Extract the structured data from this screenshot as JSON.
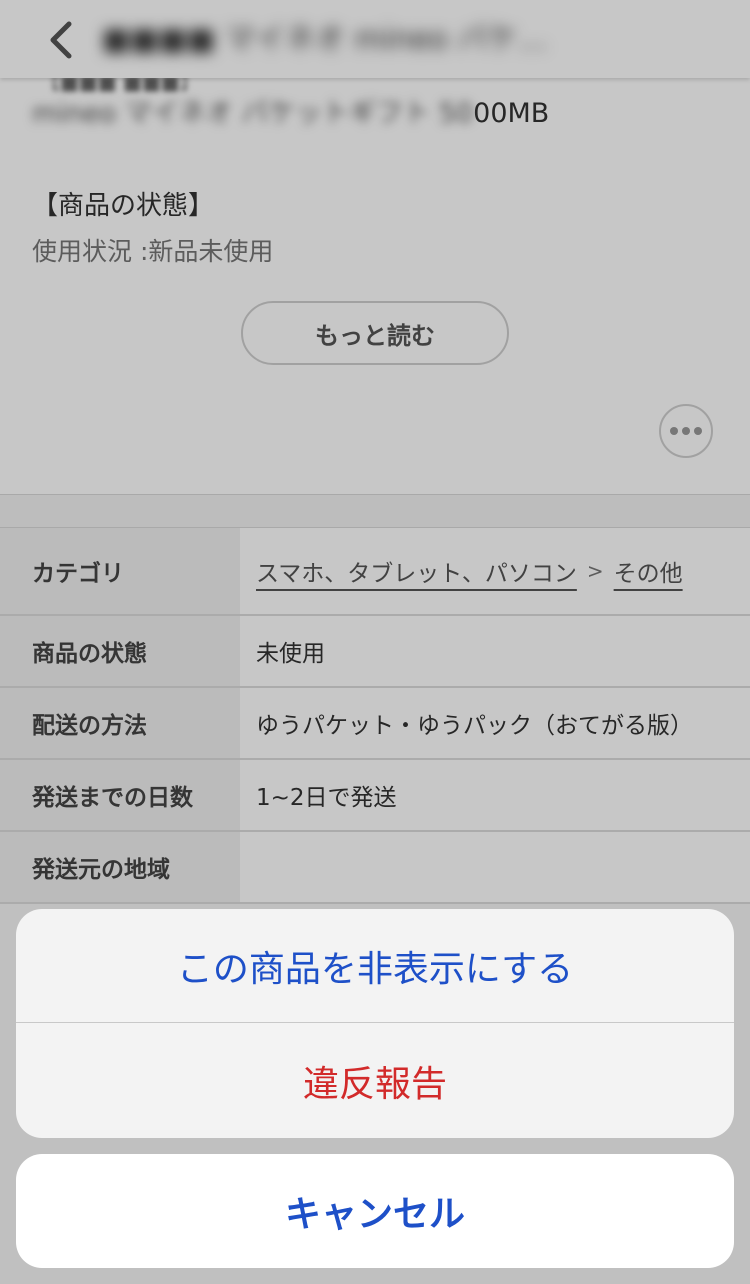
{
  "navbar": {
    "title": "■■■■ マイネオ mineo パケ…"
  },
  "description": {
    "cut_line": "【■■■ ■■■】",
    "line1_blurred": "mineo マイネオ パケットギフト 50",
    "line1_visible": "00MB",
    "heading": "【商品の状態】",
    "line2": "使用状況 :新品未使用",
    "read_more": "もっと読む"
  },
  "info": {
    "rows": [
      {
        "label": "カテゴリ",
        "link1": "スマホ、タブレット、パソコン",
        "separator": ">",
        "link2": "その他"
      },
      {
        "label": "商品の状態",
        "value": "未使用"
      },
      {
        "label": "配送の方法",
        "value": "ゆうパケット・ゆうパック（おてがる版）"
      },
      {
        "label": "発送までの日数",
        "value": "1~2日で発送"
      },
      {
        "label": "発送元の地域",
        "value": ""
      }
    ]
  },
  "action_sheet": {
    "hide_item": "この商品を非表示にする",
    "report": "違反報告",
    "cancel": "キャンセル"
  },
  "colors": {
    "action_blue": "#1e50c8",
    "destructive_red": "#d22a2a"
  }
}
